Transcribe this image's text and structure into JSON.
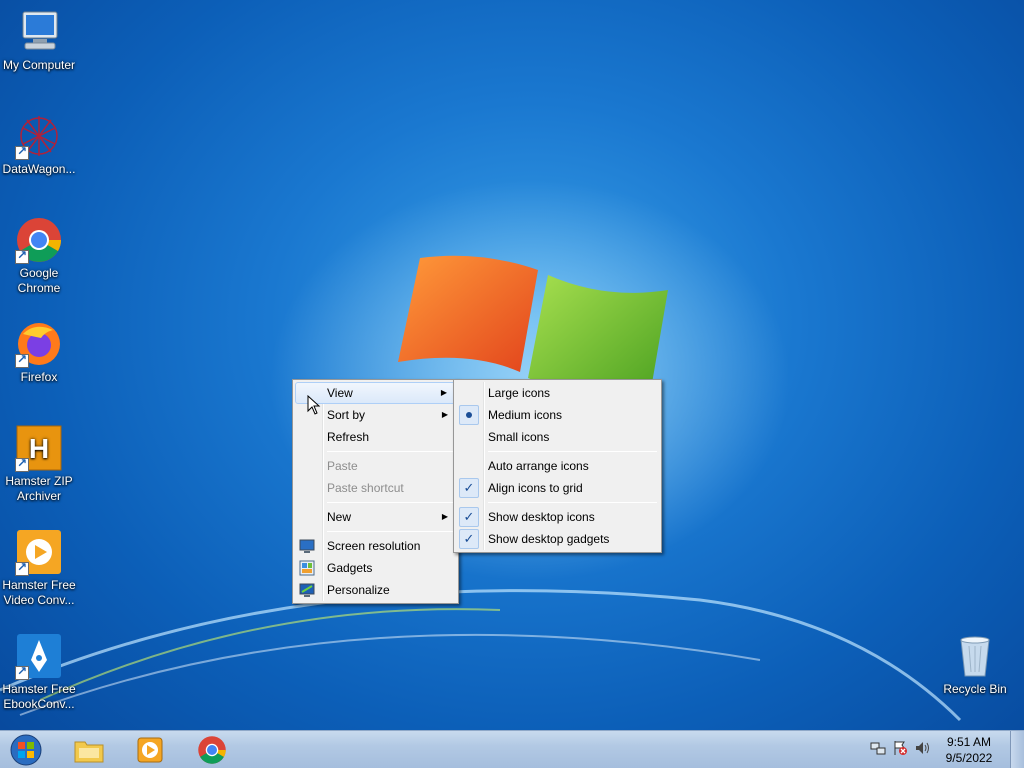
{
  "desktop": {
    "icons": [
      {
        "label": "My Computer",
        "icon": "computer-icon"
      },
      {
        "label": "DataWagon...",
        "icon": "datawagon-icon"
      },
      {
        "label": "Google Chrome",
        "icon": "chrome-icon"
      },
      {
        "label": "Firefox",
        "icon": "firefox-icon"
      },
      {
        "label": "Hamster ZIP Archiver",
        "icon": "hamster-zip-icon"
      },
      {
        "label": "Hamster Free Video Conv...",
        "icon": "hamster-video-icon"
      },
      {
        "label": "Hamster Free EbookConv...",
        "icon": "hamster-ebook-icon"
      },
      {
        "label": "Recycle Bin",
        "icon": "recycle-bin-icon"
      }
    ]
  },
  "context_menu": {
    "items": [
      {
        "label": "View",
        "submenu": true,
        "highlighted": true
      },
      {
        "label": "Sort by",
        "submenu": true
      },
      {
        "label": "Refresh"
      },
      {
        "label": "Paste",
        "disabled": true
      },
      {
        "label": "Paste shortcut",
        "disabled": true
      },
      {
        "label": "New",
        "submenu": true
      },
      {
        "label": "Screen resolution",
        "icon": "screen-resolution-icon"
      },
      {
        "label": "Gadgets",
        "icon": "gadgets-icon"
      },
      {
        "label": "Personalize",
        "icon": "personalize-icon"
      }
    ]
  },
  "view_submenu": {
    "items": [
      {
        "label": "Large icons"
      },
      {
        "label": "Medium icons",
        "selected": true
      },
      {
        "label": "Small icons"
      },
      {
        "label": "Auto arrange icons"
      },
      {
        "label": "Align icons to grid",
        "checked": true
      },
      {
        "label": "Show desktop icons",
        "checked": true
      },
      {
        "label": "Show desktop gadgets",
        "checked": true
      }
    ]
  },
  "taskbar": {
    "pinned": [
      "file-explorer-icon",
      "media-player-icon",
      "chrome-icon"
    ],
    "tray_icons": [
      "network-icon",
      "action-center-flag-icon",
      "volume-icon"
    ],
    "clock": {
      "time": "9:51 AM",
      "date": "9/5/2022"
    }
  },
  "colors": {
    "menu_bg": "#f0f0f0",
    "menu_highlight": "#dbe9fa",
    "desktop_blue": "#1a78d0",
    "taskbar": "#b2c9e4"
  }
}
